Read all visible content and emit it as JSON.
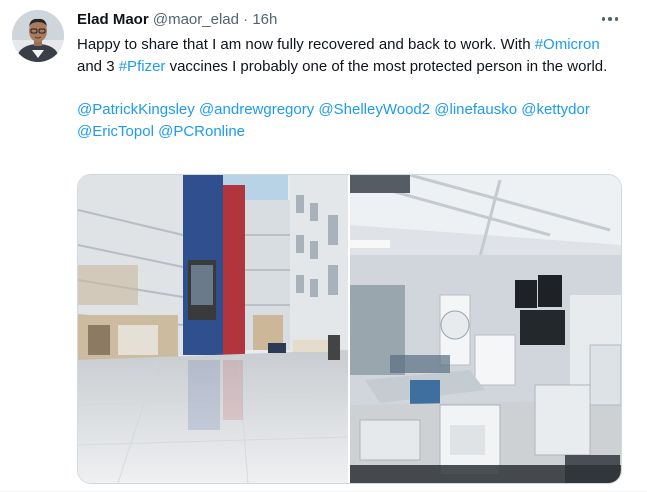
{
  "author": {
    "name": "Elad Maor",
    "handle": "@maor_elad",
    "separator": "·",
    "time": "16h"
  },
  "menu_icon": "more-horizontal-icon",
  "body": {
    "line1_before": "Happy to share that I am now fully recovered and back to work. With ",
    "hashtag1": "#Omicron",
    "mid": " and 3 ",
    "hashtag2": "#Pfizer",
    "after": " vaccines I probably one of the most protected person in the world.",
    "mentions": [
      "@PatrickKingsley",
      "@andrewgregory",
      "@ShelleyWood2",
      "@linefausko",
      "@kettydor",
      "@EricTopol",
      "@PCRonline"
    ]
  },
  "media": [
    {
      "kind": "photo",
      "subject": "hospital-atrium"
    },
    {
      "kind": "photo",
      "subject": "catheterization-lab"
    }
  ]
}
